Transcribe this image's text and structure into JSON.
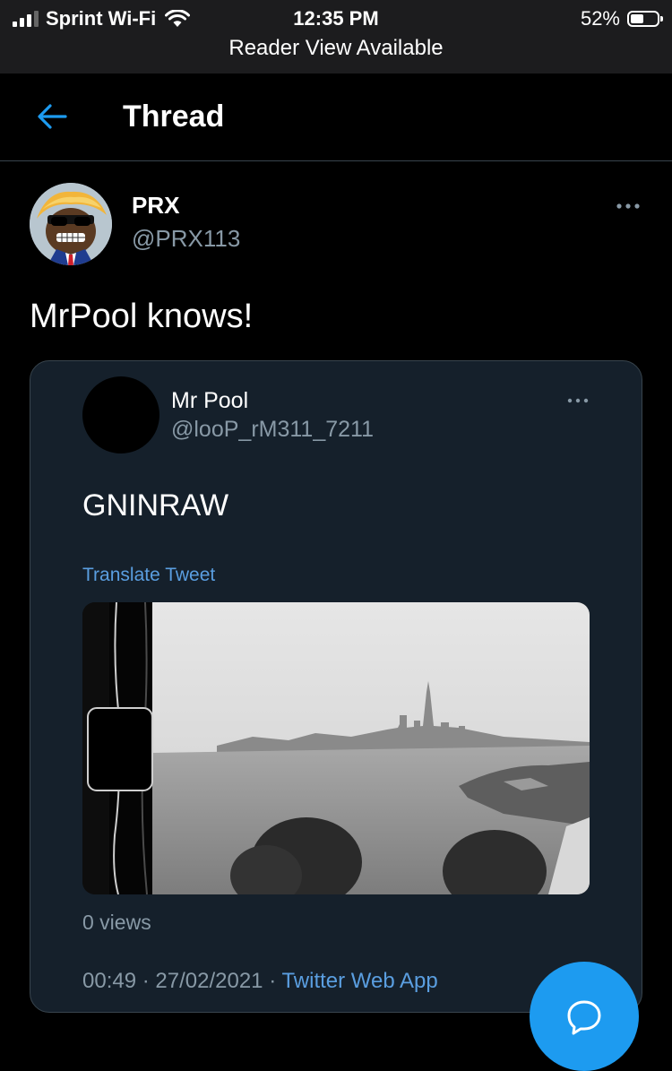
{
  "status_bar": {
    "carrier": "Sprint Wi-Fi",
    "time": "12:35 PM",
    "battery": "52%",
    "battery_level": 0.52,
    "reader_view": "Reader View Available"
  },
  "header": {
    "title": "Thread",
    "back_icon": "arrow-left-icon"
  },
  "tweet": {
    "author_name": "PRX",
    "author_handle": "@PRX113",
    "text": "MrPool knows!",
    "more_icon": "more-horizontal-icon"
  },
  "quoted_tweet": {
    "author_name": "Mr Pool",
    "author_handle": "@looP_rM311_7211",
    "text": "GNINRAW",
    "translate_label": "Translate Tweet",
    "views": "0 views",
    "time": "00:49",
    "date": "27/02/2021",
    "separator": "·",
    "source_app": "Twitter Web App"
  },
  "fab": {
    "icon": "compose-reply-icon"
  },
  "colors": {
    "background": "#000000",
    "card": "#15202b",
    "border": "#38444d",
    "secondary_text": "#8899a6",
    "link": "#5a9ee0",
    "accent": "#1d9bf0"
  }
}
